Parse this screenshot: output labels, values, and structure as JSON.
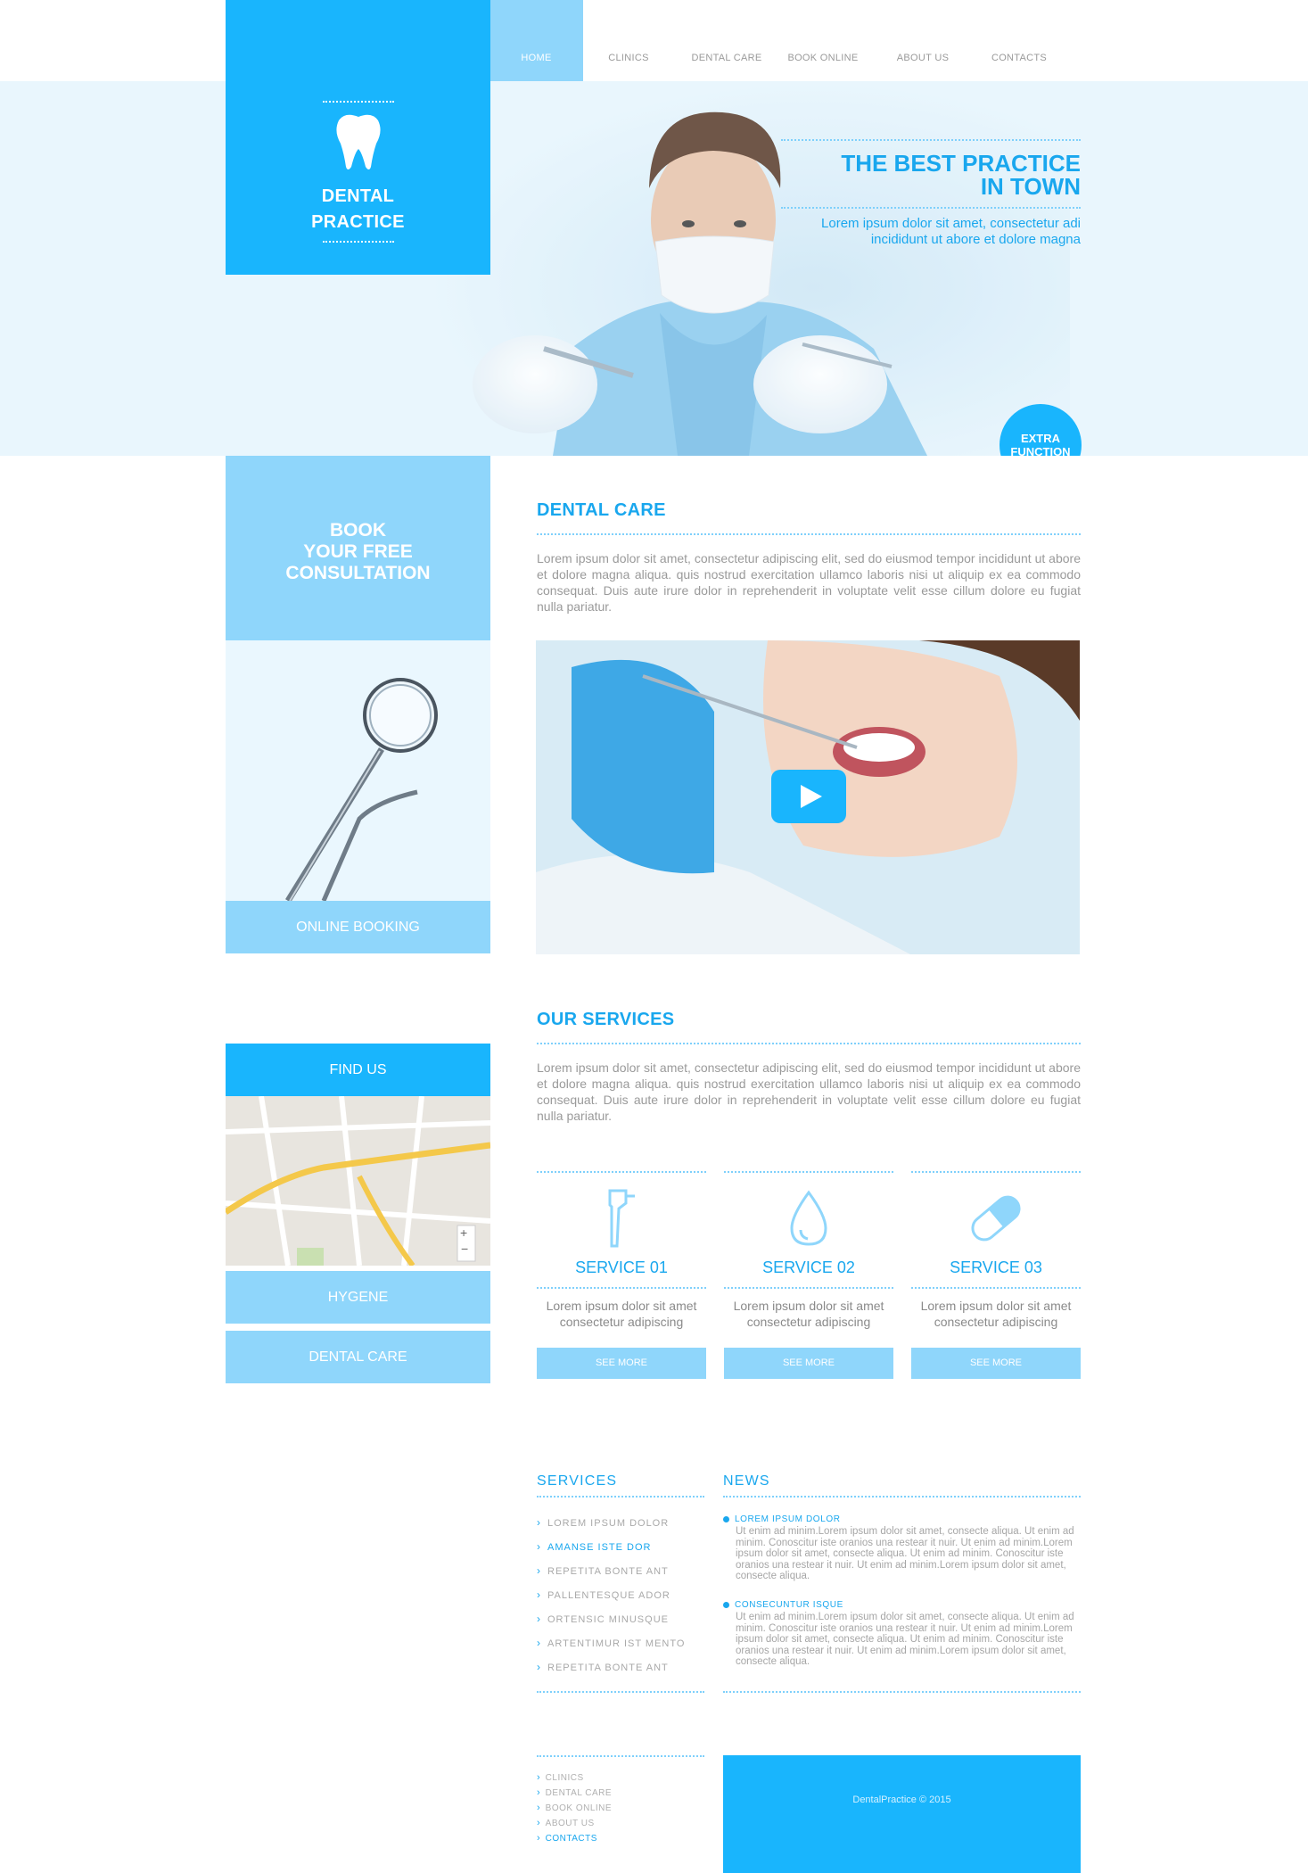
{
  "nav": {
    "items": [
      "HOME",
      "CLINICS",
      "DENTAL CARE",
      "BOOK ONLINE",
      "ABOUT US",
      "CONTACTS"
    ]
  },
  "logo": {
    "line1": "DENTAL",
    "line2": "PRACTICE"
  },
  "hero": {
    "title_line1": "THE BEST PRACTICE",
    "title_line2": "IN TOWN",
    "subtitle_line1": "Lorem ipsum dolor sit amet, consectetur adi",
    "subtitle_line2": "incididunt ut abore et dolore magna",
    "extra_line1": "EXTRA",
    "extra_line2": "FUNCTION",
    "slides": 3,
    "active_slide": 1
  },
  "book": {
    "line1": "BOOK",
    "line2": "YOUR FREE",
    "line3": "CONSULTATION",
    "online_booking": "ONLINE BOOKING"
  },
  "dental_care": {
    "heading": "DENTAL CARE",
    "text": "Lorem ipsum dolor sit amet, consectetur adipiscing elit, sed do eiusmod tempor incididunt ut abore et dolore magna aliqua. quis nostrud exercitation ullamco laboris nisi ut aliquip ex ea commodo consequat. Duis aute irure dolor in reprehenderit in voluptate velit esse cillum dolore eu fugiat nulla pariatur."
  },
  "sidebar": {
    "find_us": "FIND US",
    "hygene": "HYGENE",
    "dental_care": "DENTAL CARE"
  },
  "services": {
    "heading": "OUR SERVICES",
    "text": "Lorem ipsum dolor sit amet, consectetur adipiscing elit, sed do eiusmod tempor incididunt ut abore et dolore magna aliqua. quis nostrud exercitation ullamco laboris nisi ut aliquip ex ea commodo consequat. Duis aute irure dolor in reprehenderit in voluptate velit esse cillum dolore eu fugiat nulla pariatur.",
    "items": [
      {
        "title": "SERVICE 01",
        "desc1": "Lorem ipsum dolor sit amet",
        "desc2": "consectetur adipiscing",
        "button": "SEE MORE",
        "icon": "dental-tool-icon"
      },
      {
        "title": "SERVICE 02",
        "desc1": "Lorem ipsum dolor sit amet",
        "desc2": "consectetur adipiscing",
        "button": "SEE MORE",
        "icon": "water-drop-icon"
      },
      {
        "title": "SERVICE 03",
        "desc1": "Lorem ipsum dolor sit amet",
        "desc2": "consectetur adipiscing",
        "button": "SEE MORE",
        "icon": "pill-icon"
      }
    ]
  },
  "links": {
    "heading": "SERVICES",
    "items": [
      "LOREM IPSUM DOLOR",
      "AMANSE ISTE DOR",
      "REPETITA BONTE ANT",
      "PALLENTESQUE ADOR",
      "ORTENSIC MINUSQUE",
      "ARTENTIMUR IST MENTO",
      "REPETITA BONTE ANT"
    ]
  },
  "news": {
    "heading": "NEWS",
    "items": [
      {
        "title": "LOREM IPSUM DOLOR",
        "body": "Ut enim ad minim.Lorem ipsum dolor sit amet, consecte aliqua. Ut enim ad minim. Conoscitur iste oranios una restear it nuir. Ut enim ad minim.Lorem ipsum dolor sit amet, consecte aliqua. Ut enim ad minim. Conoscitur iste oranios una restear it nuir. Ut enim ad minim.Lorem ipsum dolor sit amet, consecte aliqua."
      },
      {
        "title": "CONSECUNTUR ISQUE",
        "body": "Ut enim ad minim.Lorem ipsum dolor sit amet, consecte aliqua. Ut enim ad minim. Conoscitur iste oranios una restear it nuir. Ut enim ad minim.Lorem ipsum dolor sit amet, consecte aliqua. Ut enim ad minim. Conoscitur iste oranios una restear it nuir. Ut enim ad minim.Lorem ipsum dolor sit amet, consecte aliqua."
      }
    ]
  },
  "footer": {
    "links": [
      "CLINICS",
      "DENTAL CARE",
      "BOOK ONLINE",
      "ABOUT US",
      "CONTACTS"
    ],
    "copyright": "DentalPractice © 2015"
  },
  "colors": {
    "primary": "#19b5fd",
    "light": "#8fd6fb",
    "pale": "#e9f6fd"
  }
}
